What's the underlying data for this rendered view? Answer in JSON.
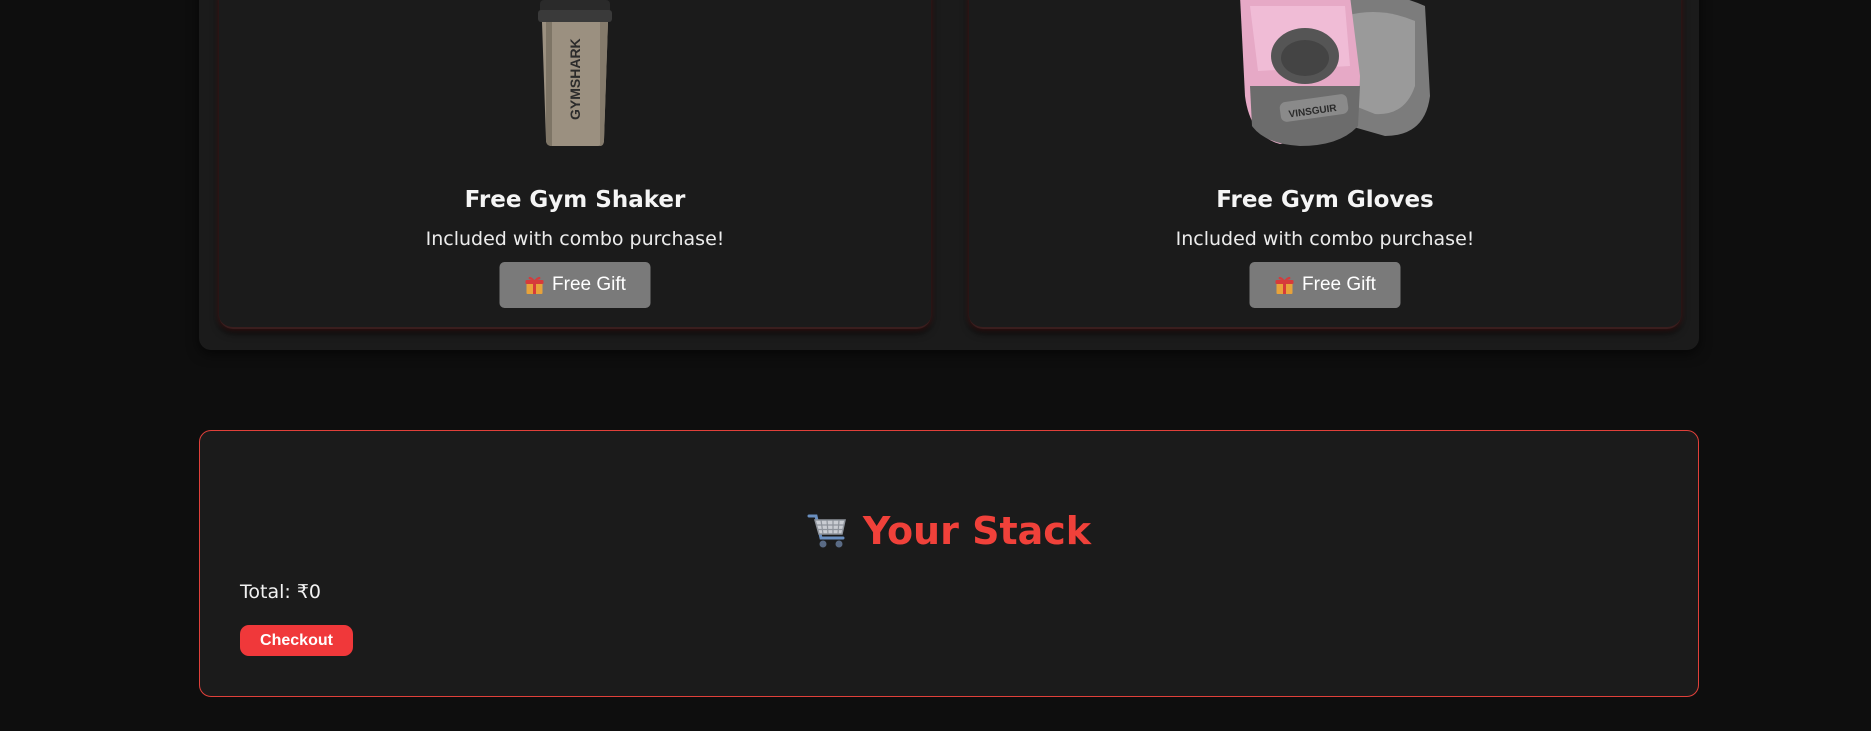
{
  "gifts": [
    {
      "title": "Free Gym Shaker",
      "subtitle": "Included with combo purchase!",
      "button_label": "Free Gift",
      "button_icon": "gift-icon",
      "image": "gym-shaker-image",
      "brand_text": "GYMSHARK"
    },
    {
      "title": "Free Gym Gloves",
      "subtitle": "Included with combo purchase!",
      "button_label": "Free Gift",
      "button_icon": "gift-icon",
      "image": "gym-gloves-image",
      "brand_text": "VINSGUIR"
    }
  ],
  "stack": {
    "icon": "shopping-cart-icon",
    "title": "Your Stack",
    "total_label": "Total: ₹0",
    "checkout_label": "Checkout"
  },
  "colors": {
    "page_bg": "#0e0e0e",
    "panel_bg": "#1b1b1b",
    "accent_red": "#f0413a",
    "gift_button_bg": "#7a7a7a"
  }
}
